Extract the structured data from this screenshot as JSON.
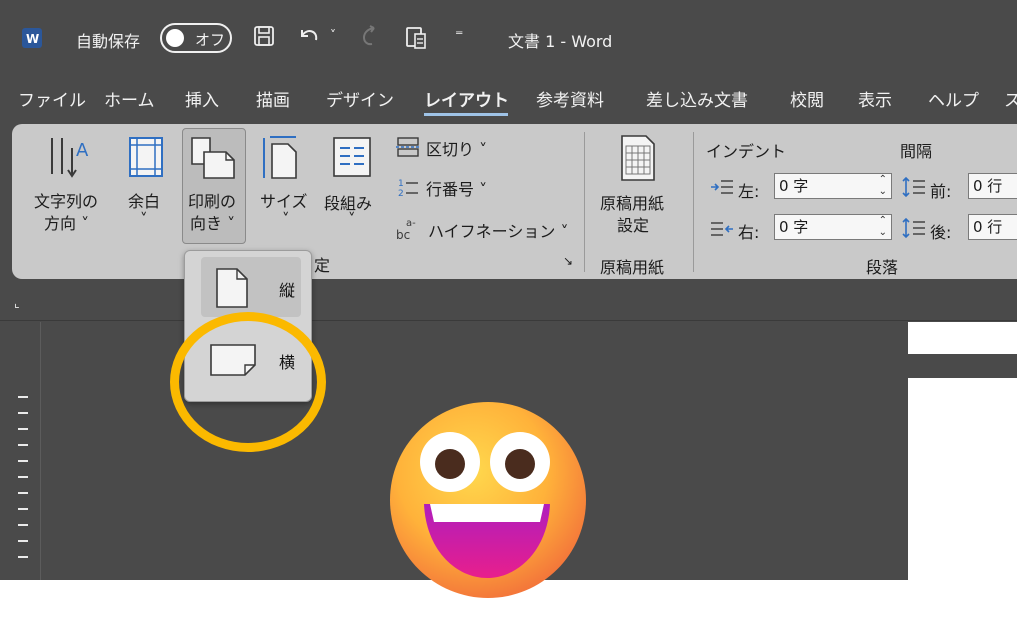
{
  "titlebar": {
    "app_icon": "word-logo-icon",
    "autosave_label": "自動保存",
    "autosave_state": "オフ",
    "document_title": "文書 1  -  Word"
  },
  "menu": {
    "tabs": [
      "ファイル",
      "ホーム",
      "挿入",
      "描画",
      "デザイン",
      "レイアウト",
      "参考資料",
      "差し込み文書",
      "校閲",
      "表示",
      "ヘルプ"
    ],
    "active_tab": "レイアウト",
    "overflow": "ス"
  },
  "ribbon": {
    "text_direction": {
      "line1": "文字列の",
      "line2": "方向 ˅"
    },
    "margins": {
      "line1": "余白",
      "line2": "˅"
    },
    "orientation": {
      "line1": "印刷の",
      "line2": "向き ˅"
    },
    "size": {
      "line1": "サイズ",
      "line2": "˅"
    },
    "columns": {
      "line1": "段組み",
      "line2": "˅"
    },
    "breaks": "区切り ˅",
    "line_numbers": "行番号 ˅",
    "hyphenation": "ハイフネーション ˅",
    "page_setup_group": "定",
    "genko": {
      "line1": "原稿用紙",
      "line2": "設定",
      "group": "原稿用紙"
    },
    "indent": {
      "title": "インデント",
      "left_label": "左:",
      "left_value": "0 字",
      "right_label": "右:",
      "right_value": "0 字"
    },
    "spacing": {
      "title": "間隔",
      "before_label": "前:",
      "before_value": "0 行",
      "after_label": "後:",
      "after_value": "0 行"
    },
    "paragraph_group": "段落"
  },
  "orientation_menu": {
    "portrait": "縦",
    "landscape": "横"
  },
  "colors": {
    "highlight_ring": "#fbb900",
    "active_tab_underline": "#9fc3e7"
  }
}
